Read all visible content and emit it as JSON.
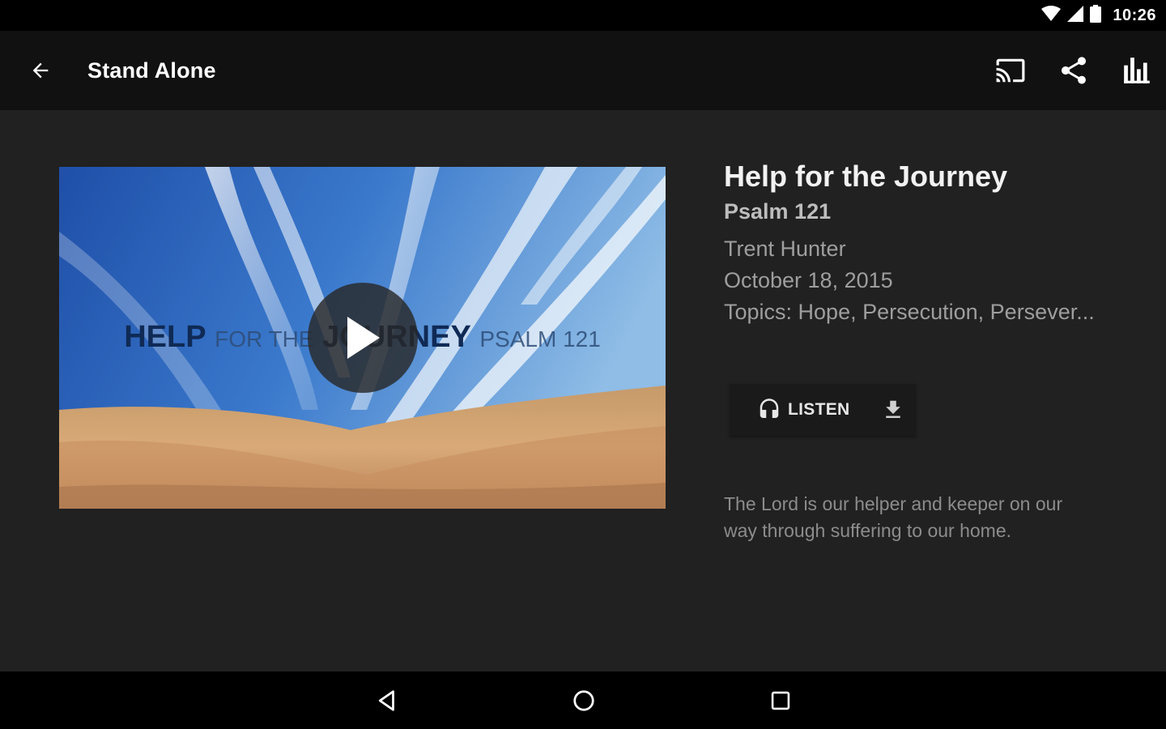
{
  "status_bar": {
    "time": "10:26",
    "icons": [
      "wifi-icon",
      "cell-signal-icon",
      "battery-icon"
    ]
  },
  "app_bar": {
    "title": "Stand Alone",
    "icons": [
      "back-arrow-icon",
      "cast-icon",
      "share-icon",
      "stats-icon"
    ]
  },
  "video": {
    "overlay_text": {
      "word1": "HELP",
      "word2": "FOR THE",
      "word3": "JOURNEY",
      "word4": "PSALM 121"
    },
    "play_icon": "play-icon"
  },
  "sermon": {
    "title": "Help for the Journey",
    "scripture": "Psalm 121",
    "speaker": "Trent Hunter",
    "date": "October 18, 2015",
    "topics": "Topics: Hope, Persecution, Persever..."
  },
  "actions": {
    "listen_label": "LISTEN",
    "listen_icon": "headphones-icon",
    "download_icon": "download-icon"
  },
  "description": "The Lord is our helper and keeper on our way through suffering to our home.",
  "nav_bar": {
    "icons": [
      "back-triangle-icon",
      "home-circle-icon",
      "recents-square-icon"
    ]
  },
  "colors": {
    "content_bg": "#212121",
    "app_bar_bg": "#111111",
    "text_primary": "#f2f2f2",
    "text_secondary": "#9e9e9e"
  }
}
